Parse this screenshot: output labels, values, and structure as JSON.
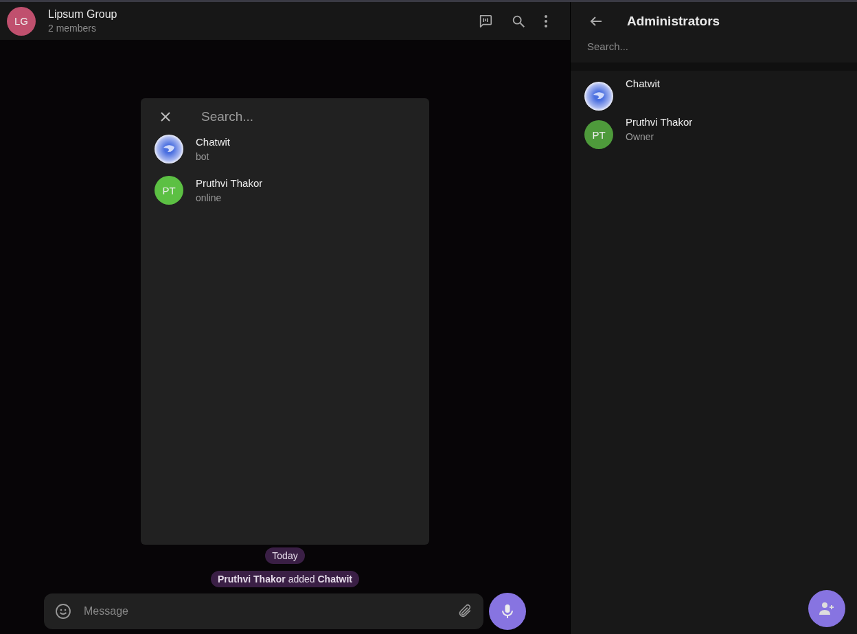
{
  "chat_header": {
    "title": "Lipsum Group",
    "subtitle": "2 members",
    "avatar": {
      "initials": "LG",
      "color": "#c0506e"
    }
  },
  "mention_popup": {
    "search": {
      "placeholder": "Search..."
    },
    "members": [
      {
        "name": "Chatwit",
        "status": "bot",
        "avatar": {
          "kind": "logo"
        }
      },
      {
        "name": "Pruthvi Thakor",
        "status": "online",
        "avatar": {
          "kind": "initials",
          "initials": "PT",
          "color": "#5cc043"
        }
      }
    ]
  },
  "service_messages": [
    "Today",
    "**Pruthvi Thakor** added **Chatwit**"
  ],
  "composer": {
    "placeholder": "Message"
  },
  "admin_panel": {
    "title": "Administrators",
    "search": {
      "placeholder": "Search..."
    },
    "admins": [
      {
        "name": "Chatwit",
        "avatar": {
          "kind": "logo"
        }
      },
      {
        "name": "Pruthvi Thakor",
        "role": "Owner",
        "avatar": {
          "kind": "initials",
          "initials": "PT",
          "color": "#4e9a3b"
        }
      }
    ]
  }
}
